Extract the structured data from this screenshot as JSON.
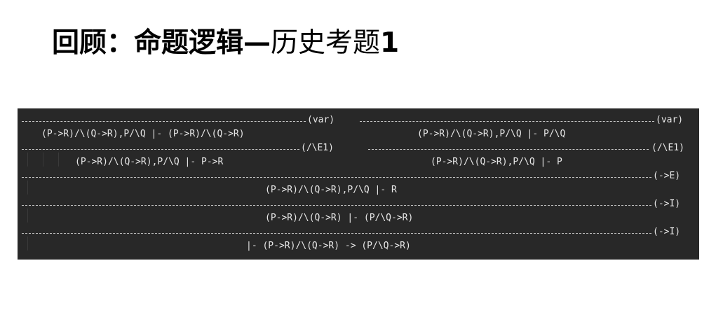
{
  "slide": {
    "title_bold": "回顾：命题逻辑—",
    "title_regular": "历史考题",
    "title_number": "1"
  },
  "proof": {
    "rules": {
      "var": "(var)",
      "and_elim1": "(/\\E1)",
      "imp_elim": "(->E)",
      "imp_intro": "(->I)"
    },
    "left_top": "(P->R)/\\(Q->R),P/\\Q |- (P->R)/\\(Q->R)",
    "right_top": "(P->R)/\\(Q->R),P/\\Q |- P/\\Q",
    "left_mid": "(P->R)/\\(Q->R),P/\\Q |- P->R",
    "right_mid": "(P->R)/\\(Q->R),P/\\Q |- P",
    "line3": "(P->R)/\\(Q->R),P/\\Q |- R",
    "line4": "(P->R)/\\(Q->R) |- (P/\\Q->R)",
    "line5": "|- (P->R)/\\(Q->R) -> (P/\\Q->R)"
  }
}
